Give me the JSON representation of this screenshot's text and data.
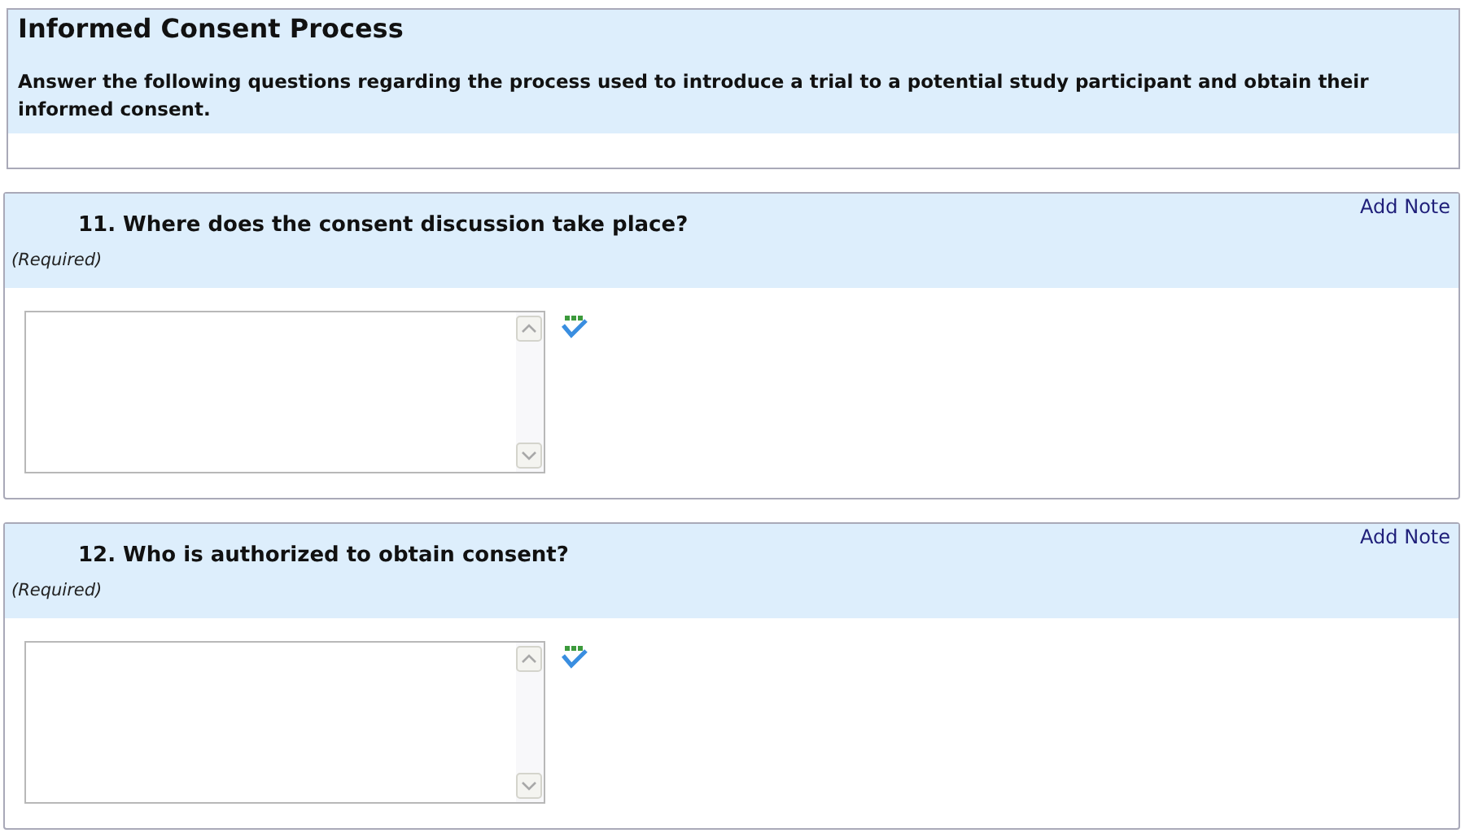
{
  "header": {
    "title": "Informed Consent Process",
    "instructions": "Answer the following questions regarding the process used to introduce a trial to a potential study participant and obtain their informed consent."
  },
  "questions": [
    {
      "number": "11.",
      "text": "Where does the consent discussion take place?",
      "required": "(Required)",
      "note_link": "Add Note"
    },
    {
      "number": "12.",
      "text": "Who is authorized to obtain consent?",
      "required": "(Required)",
      "note_link": "Add Note"
    }
  ]
}
